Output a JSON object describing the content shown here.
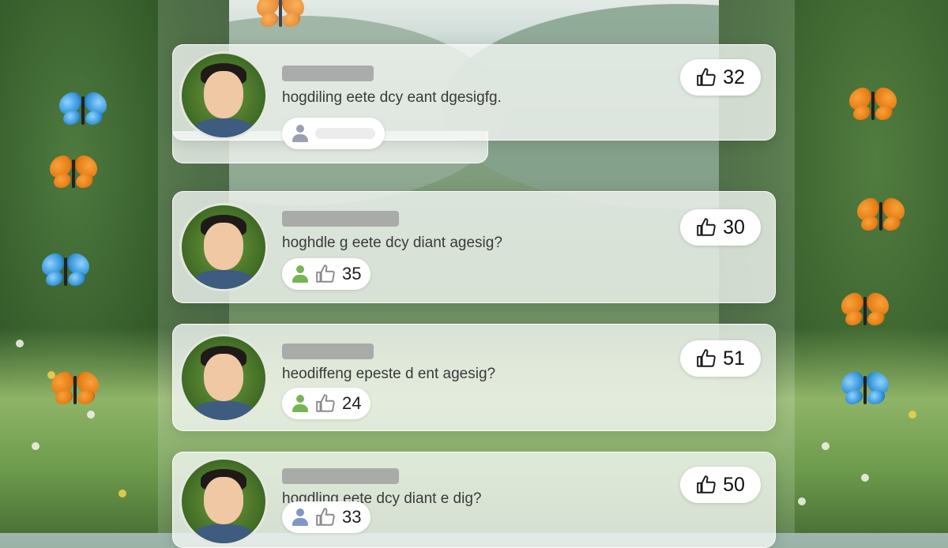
{
  "comments": [
    {
      "text": "hogdiling eete dcy eant dgesigfg.",
      "likes": "32",
      "reply_count": ""
    },
    {
      "text": "hoghdle g eete dcy diant agesig?",
      "likes": "30",
      "reply_count": "35"
    },
    {
      "text": "heodiffeng epeste d ent agesig?",
      "likes": "51",
      "reply_count": "24"
    },
    {
      "text": "hogdling eete dcy diant e dig?",
      "likes": "50",
      "reply_count": "33"
    }
  ],
  "icons": {
    "user": "user-icon",
    "like": "thumbs-up-icon"
  },
  "colors": {
    "card_bg": "#f6f8f6",
    "user_gray": "#9aa0ad",
    "user_green": "#79b356",
    "user_blue": "#7d97c8"
  }
}
